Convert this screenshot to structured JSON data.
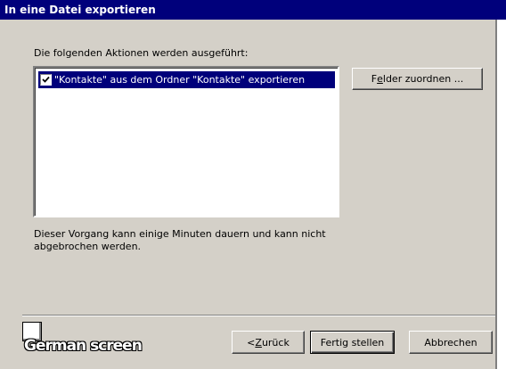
{
  "window": {
    "title": "In eine Datei exportieren"
  },
  "instruction": "Die folgenden Aktionen werden ausgeführt:",
  "actions": [
    {
      "label": "\"Kontakte\" aus dem Ordner \"Kontakte\" exportieren",
      "checked": true,
      "selected": true
    }
  ],
  "map_fields_button": {
    "pre": "F",
    "accel": "e",
    "post": "lder zuordnen ..."
  },
  "note": "Dieser Vorgang kann einige Minuten dauern und kann nicht abgebrochen werden.",
  "footer": {
    "back_button": {
      "pre": "< ",
      "accel": "Z",
      "post": "urück"
    },
    "finish_button": "Fertig stellen",
    "cancel_button": "Abbrechen"
  },
  "caption": "German screen",
  "icons": {
    "help": "help-icon",
    "checkbox": "checkmark-icon"
  },
  "colors": {
    "titlebar": "#00007b",
    "face": "#d4d0c8",
    "selection": "#00007b"
  }
}
